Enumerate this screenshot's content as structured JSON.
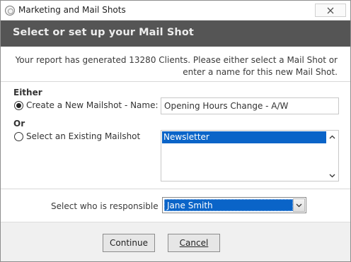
{
  "window": {
    "title": "Marketing and Mail Shots"
  },
  "banner": {
    "heading": "Select or set up your Mail Shot"
  },
  "info": {
    "line1": "Your report has generated 13280 Clients. Please either select a Mail Shot or",
    "line2": "enter a name for this new Mail Shot."
  },
  "options": {
    "either_label": "Either",
    "create_label": "Create a New Mailshot - Name:",
    "create_selected": true,
    "name_value": "Opening Hours Change - A/W",
    "or_label": "Or",
    "existing_label": "Select an Existing Mailshot",
    "existing_selected": false,
    "mailshots": [
      "Newsletter"
    ]
  },
  "responsible": {
    "label": "Select who is responsible",
    "selected": "Jane Smith"
  },
  "footer": {
    "continue_label": "Continue",
    "cancel_label": "Cancel"
  },
  "colors": {
    "banner_bg": "#555555",
    "selection": "#0a64c8"
  },
  "icons": {
    "close": "close-icon",
    "app": "app-icon",
    "scroll_up": "chevron-up-icon",
    "scroll_down": "chevron-down-icon",
    "dropdown": "chevron-down-icon"
  }
}
